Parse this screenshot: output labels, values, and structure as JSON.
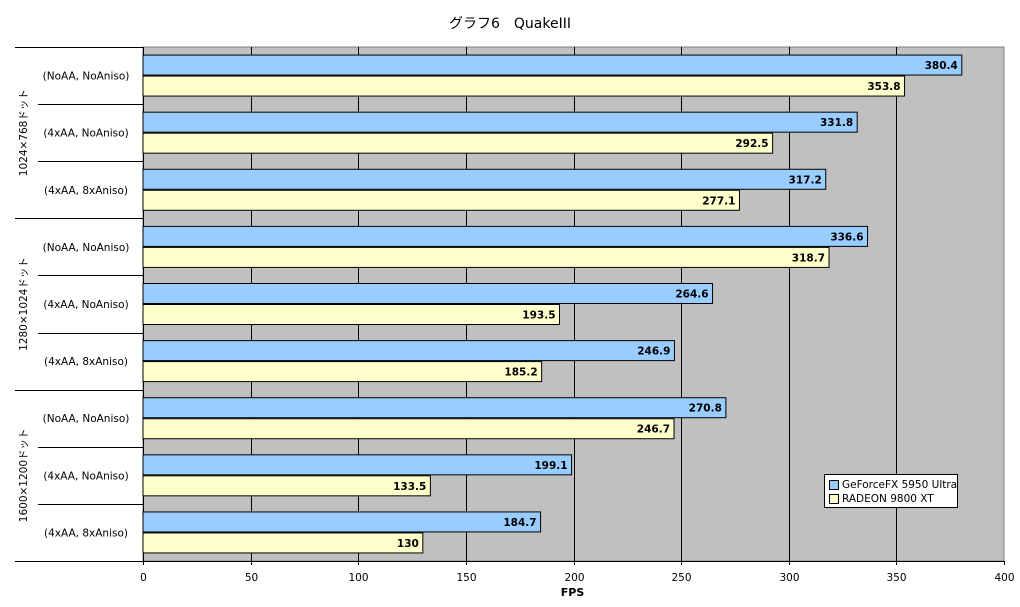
{
  "chart_data": {
    "type": "bar",
    "orientation": "horizontal",
    "title": "グラフ6　QuakeIII",
    "xlabel": "FPS",
    "ylabel": "",
    "xlim": [
      0,
      400
    ],
    "x_ticks": [
      "0",
      "50",
      "100",
      "150",
      "200",
      "250",
      "300",
      "350",
      "400"
    ],
    "grid": "vertical gridlines",
    "legend_position": "bottom-right",
    "groups": [
      {
        "label": "1024×768ドット",
        "categories": [
          "(NoAA, NoAniso)",
          "(4xAA, NoAniso)",
          "(4xAA, 8xAniso)"
        ]
      },
      {
        "label": "1280×1024ドット",
        "categories": [
          "(NoAA, NoAniso)",
          "(4xAA, NoAniso)",
          "(4xAA, 8xAniso)"
        ]
      },
      {
        "label": "1600×1200ドット",
        "categories": [
          "(NoAA, NoAniso)",
          "(4xAA, NoAniso)",
          "(4xAA, 8xAniso)"
        ]
      }
    ],
    "series": [
      {
        "name": "GeForceFX 5950 Ultra",
        "color": "#99ccff",
        "values": [
          380.4,
          331.8,
          317.2,
          336.6,
          264.6,
          246.9,
          270.8,
          199.1,
          184.7
        ]
      },
      {
        "name": "RADEON 9800 XT",
        "color": "#ffffcc",
        "values": [
          353.8,
          292.5,
          277.1,
          318.7,
          193.5,
          185.2,
          246.7,
          133.5,
          130
        ]
      }
    ],
    "value_labels": [
      [
        "380.4",
        "331.8",
        "317.2",
        "336.6",
        "264.6",
        "246.9",
        "270.8",
        "199.1",
        "184.7"
      ],
      [
        "353.8",
        "292.5",
        "277.1",
        "318.7",
        "193.5",
        "185.2",
        "246.7",
        "133.5",
        "130"
      ]
    ],
    "colors": {
      "plot_background": "#c0c0c0",
      "gridline": "#000000"
    }
  }
}
